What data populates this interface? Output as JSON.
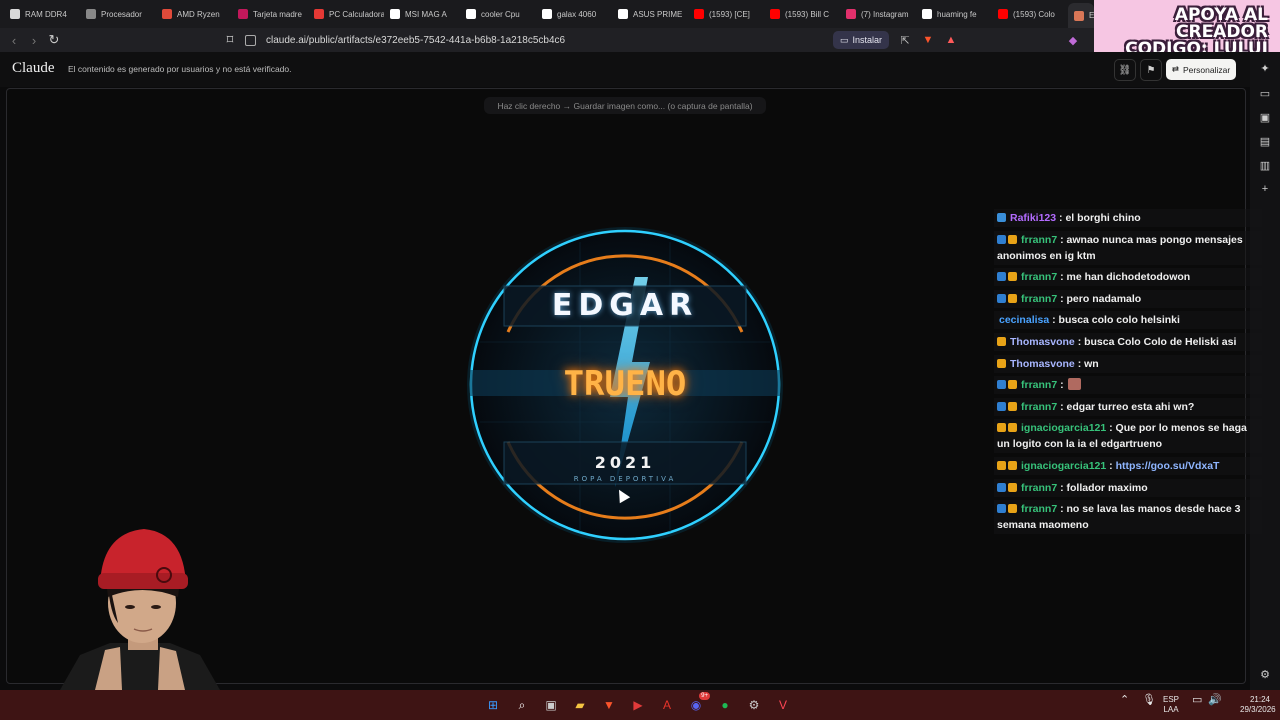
{
  "browser": {
    "tabs": [
      {
        "label": "RAM DDR4",
        "icon": "brand-icon",
        "color": "#d9d9d9"
      },
      {
        "label": "Procesador",
        "icon": "site-icon",
        "color": "#888888"
      },
      {
        "label": "AMD Ryzen",
        "icon": "shop-icon",
        "color": "#e04a3a"
      },
      {
        "label": "Tarjeta madre",
        "icon": "shop-icon",
        "color": "#c2185b"
      },
      {
        "label": "PC Calculadora",
        "icon": "shield-icon",
        "color": "#e53935"
      },
      {
        "label": "MSI MAG A",
        "icon": "google-icon",
        "color": "#ffffff"
      },
      {
        "label": "cooler Cpu",
        "icon": "google-icon",
        "color": "#ffffff"
      },
      {
        "label": "galax 4060",
        "icon": "google-icon",
        "color": "#ffffff"
      },
      {
        "label": "ASUS PRIME",
        "icon": "google-icon",
        "color": "#ffffff"
      },
      {
        "label": "(1593) [CE]",
        "icon": "youtube-icon",
        "color": "#ff0000"
      },
      {
        "label": "(1593) Bill C",
        "icon": "youtube-icon",
        "color": "#ff0000"
      },
      {
        "label": "(7) Instagram",
        "icon": "instagram-icon",
        "color": "#e1306c"
      },
      {
        "label": "huaming fe",
        "icon": "google-icon",
        "color": "#ffffff"
      },
      {
        "label": "(1593) Colo",
        "icon": "youtube-icon",
        "color": "#ff0000"
      },
      {
        "label": "E",
        "icon": "claude-icon",
        "color": "#d97757"
      }
    ],
    "url": "claude.ai/public/artifacts/e372eeb5-7542-441a-b6b8-1a218c5cb4c6",
    "install_label": "Instalar"
  },
  "promo": {
    "line1": "APOYA AL CREADOR",
    "line2": "CODIGO: LULUI"
  },
  "header": {
    "brand": "Claude",
    "disclaimer": "El contenido es generado por usuarios y no está verificado.",
    "personalize_label": "Personalizar"
  },
  "artifact": {
    "hint": "Haz clic derecho → Guardar imagen como... (o captura de pantalla)",
    "logo": {
      "name": "EDGAR",
      "word": "TRUENO",
      "year": "2021",
      "subtitle": "ROPA DEPORTIVA"
    }
  },
  "chat": [
    {
      "user": "Rafiki123",
      "color": "#b36bff",
      "badges": [
        "#3a8fd9"
      ],
      "text": ": el borghi chino"
    },
    {
      "user": "frrann7",
      "color": "#37c27a",
      "badges": [
        "#2f7fd1",
        "#e8a317"
      ],
      "text": ": awnao nunca mas pongo mensajes anonimos en ig ktm"
    },
    {
      "user": "frrann7",
      "color": "#37c27a",
      "badges": [
        "#2f7fd1",
        "#e8a317"
      ],
      "text": ": me han dichodetodowon"
    },
    {
      "user": "frrann7",
      "color": "#37c27a",
      "badges": [
        "#2f7fd1",
        "#e8a317"
      ],
      "text": ": pero nadamalo"
    },
    {
      "user": "cecinalisa",
      "color": "#4aa3ff",
      "badges": [],
      "text": ": busca colo colo helsinki"
    },
    {
      "user": "Thomasvone",
      "color": "#a8b6ff",
      "badges": [
        "#e8a317"
      ],
      "text": ": busca Colo Colo de Heliski asi"
    },
    {
      "user": "Thomasvone",
      "color": "#a8b6ff",
      "badges": [
        "#e8a317"
      ],
      "text": ": wn"
    },
    {
      "user": "frrann7",
      "color": "#37c27a",
      "badges": [
        "#2f7fd1",
        "#e8a317"
      ],
      "text": ":",
      "emote": true
    },
    {
      "user": "frrann7",
      "color": "#37c27a",
      "badges": [
        "#2f7fd1",
        "#e8a317"
      ],
      "text": ": edgar turreo esta ahi wn?"
    },
    {
      "user": "ignaciogarcia121",
      "color": "#37c27a",
      "badges": [
        "#e8a317",
        "#e8a317"
      ],
      "text": ": Que por lo menos se haga un logito con la ia el edgartrueno"
    },
    {
      "user": "ignaciogarcia121",
      "color": "#37c27a",
      "badges": [
        "#e8a317",
        "#e8a317"
      ],
      "text": ":",
      "link": "https://goo.su/VdxaT"
    },
    {
      "user": "frrann7",
      "color": "#37c27a",
      "badges": [
        "#2f7fd1",
        "#e8a317"
      ],
      "text": ": follador maximo"
    },
    {
      "user": "frrann7",
      "color": "#37c27a",
      "badges": [
        "#2f7fd1",
        "#e8a317"
      ],
      "text": ": no se lava las manos desde hace 3 semana maomeno"
    }
  ],
  "taskbar": {
    "apps": [
      "windows-start-icon",
      "search-icon",
      "task-view-icon",
      "file-explorer-icon",
      "brave-icon",
      "media-player-icon",
      "adobe-icon",
      "discord-icon",
      "spotify-icon",
      "steam-icon",
      "valorant-icon"
    ],
    "discord_badge": "9+",
    "language": "ESP",
    "layout": "LAA",
    "time": "21:24",
    "date": "29/3/2026"
  }
}
